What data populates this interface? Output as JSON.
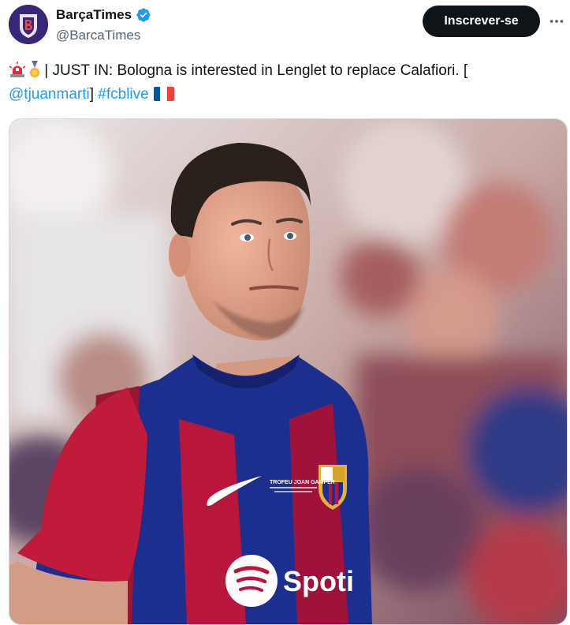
{
  "account": {
    "name": "BarçaTimes",
    "handle": "@BarcaTimes",
    "avatar_icon": "barcatimes-logo-icon",
    "verified_icon": "verified-badge-icon",
    "verified_color": "#1d9bf0"
  },
  "actions": {
    "subscribe_label": "Inscrever-se",
    "more_icon": "more-options-icon"
  },
  "tweet": {
    "emoji_siren": "siren-emoji-icon",
    "emoji_medal": "medal-emoji-icon",
    "text_main": "| JUST IN: Bologna is interested in Lenglet to replace Calafiori. [",
    "mention": "@tjuanmarti",
    "bracket_close": "] ",
    "hashtag": "#fcblive",
    "flag": "france-flag-icon"
  },
  "media": {
    "description_icon": "player-photo",
    "shirt_sponsor": "Spoti",
    "shirt_patch_line1": "TROFEU JOAN GAMPER",
    "colors": {
      "blaugrana_blue": "#1c2f8f",
      "blaugrana_red": "#b8163a"
    }
  }
}
